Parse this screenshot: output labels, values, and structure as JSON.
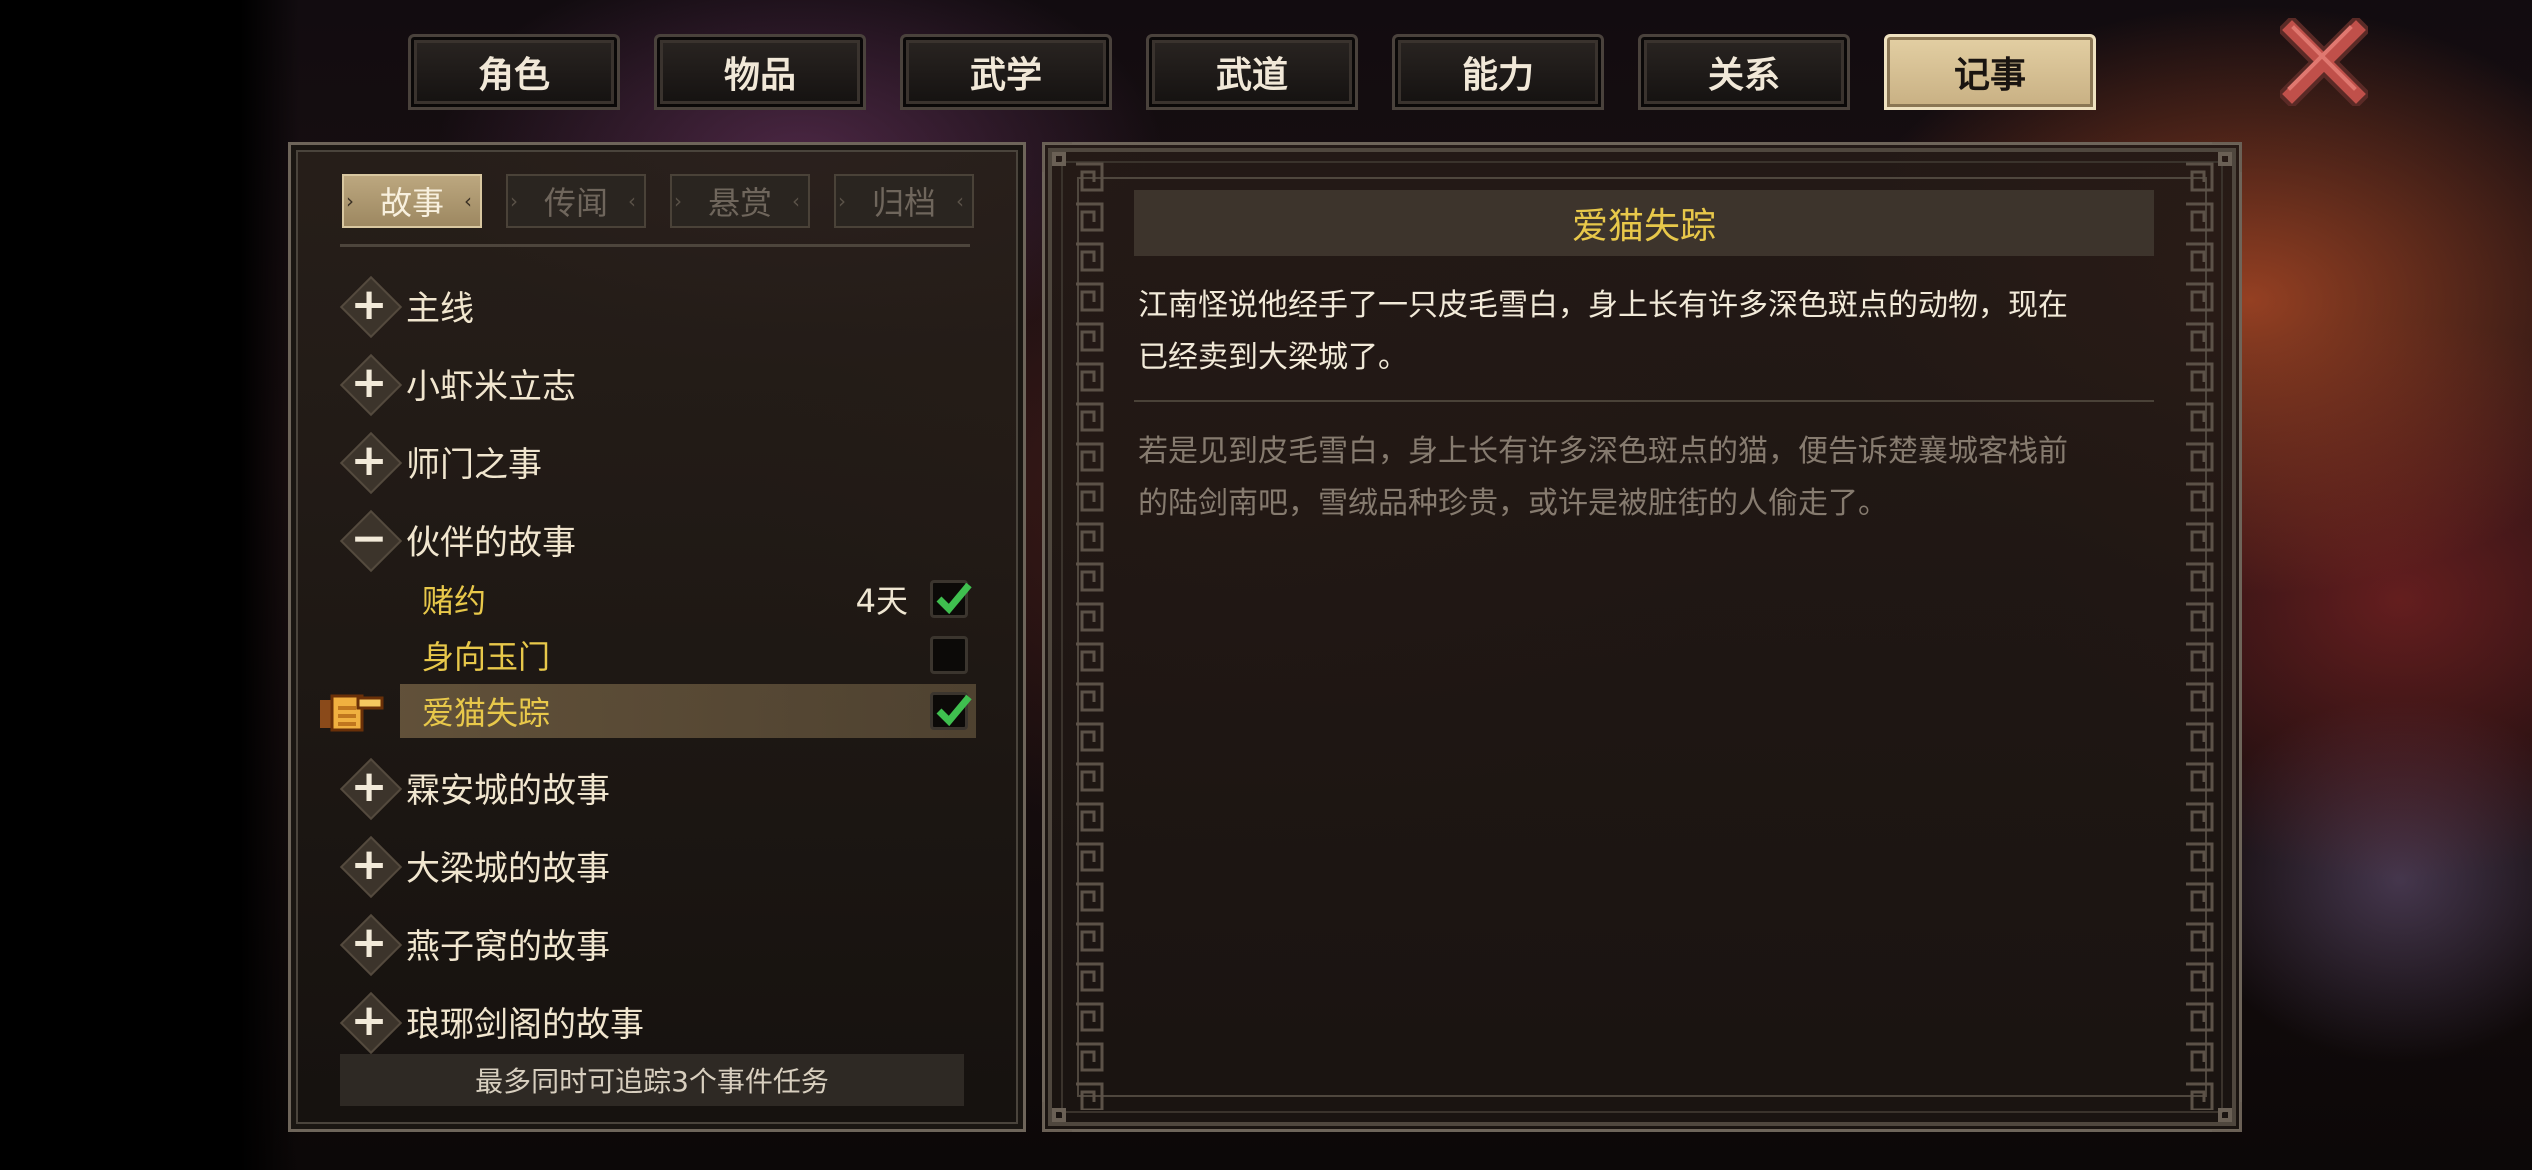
{
  "top_tabs": [
    "角色",
    "物品",
    "武学",
    "武道",
    "能力",
    "关系",
    "记事"
  ],
  "active_top_tab": "记事",
  "sub_tabs": [
    "故事",
    "传闻",
    "悬赏",
    "归档"
  ],
  "active_sub_tab": "故事",
  "categories_before": [
    {
      "symbol": "+",
      "label": "主线"
    },
    {
      "symbol": "+",
      "label": "小虾米立志"
    },
    {
      "symbol": "+",
      "label": "师门之事"
    },
    {
      "symbol": "−",
      "label": "伙伴的故事"
    }
  ],
  "quests": [
    {
      "label": "赌约",
      "days": "4天",
      "tracked": true,
      "selected": false
    },
    {
      "label": "身向玉门",
      "days": "",
      "tracked": false,
      "selected": false
    },
    {
      "label": "爱猫失踪",
      "days": "",
      "tracked": true,
      "selected": true
    }
  ],
  "categories_after": [
    {
      "symbol": "+",
      "label": "霖安城的故事"
    },
    {
      "symbol": "+",
      "label": "大梁城的故事"
    },
    {
      "symbol": "+",
      "label": "燕子窝的故事"
    },
    {
      "symbol": "+",
      "label": "琅琊剑阁的故事"
    }
  ],
  "footer_text": "最多同时可追踪3个事件任务",
  "detail": {
    "title": "爱猫失踪",
    "line1": "江南怪说他经手了一只皮毛雪白，身上长有许多深色斑点的动物，现在",
    "line2": "已经卖到大梁城了。",
    "note1": "若是见到皮毛雪白，身上长有许多深色斑点的猫，便告诉楚襄城客栈前",
    "note2": "的陆剑南吧，雪绒品种珍贵，或许是被脏街的人偷走了。"
  },
  "colors": {
    "accent_gold": "#e8c84a",
    "check_green": "#3fbf4f",
    "close_red": "#c0504a"
  }
}
